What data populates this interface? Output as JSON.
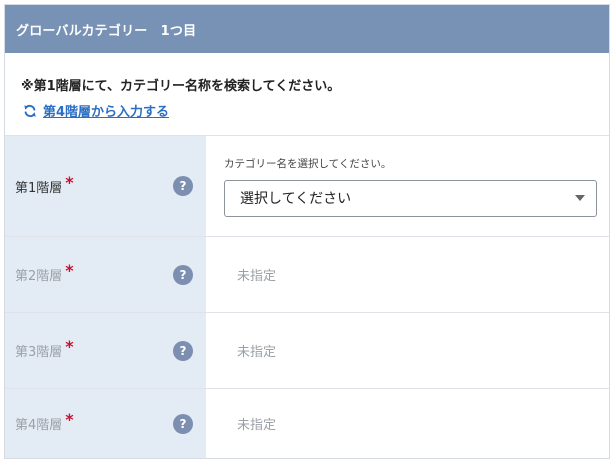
{
  "header": {
    "title": "グローバルカテゴリー　1つ目"
  },
  "notice": {
    "text": "※第1階層にて、カテゴリー名称を検索してください。",
    "switch_link": "第4階層から入力する",
    "switch_icon": "refresh-icon"
  },
  "colors": {
    "header_bg": "#7892b5",
    "label_bg": "#e3ecf5",
    "link": "#2a6fc4",
    "required": "#c8102e"
  },
  "levels": [
    {
      "label": "第1階層",
      "required": "*",
      "help": "?",
      "hint": "カテゴリー名を選択してください。",
      "select_value": "選択してください"
    },
    {
      "label": "第2階層",
      "required": "*",
      "help": "?",
      "value": "未指定"
    },
    {
      "label": "第3階層",
      "required": "*",
      "help": "?",
      "value": "未指定"
    },
    {
      "label": "第4階層",
      "required": "*",
      "help": "?",
      "value": "未指定"
    }
  ]
}
